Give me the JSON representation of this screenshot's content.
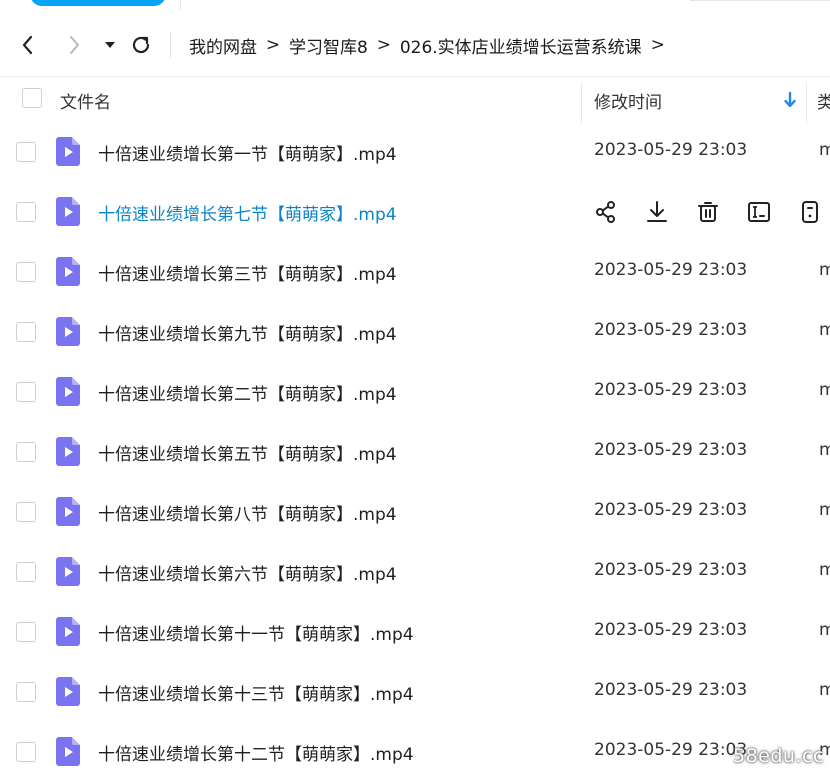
{
  "nav": {
    "back_icon": "chevron-left-icon",
    "forward_icon": "chevron-right-icon",
    "history_icon": "caret-down-icon",
    "refresh_icon": "refresh-icon",
    "breadcrumb": [
      "我的网盘",
      "学习智库8",
      "026.实体店业绩增长运营系统课"
    ],
    "separator": ">"
  },
  "header": {
    "name_col": "文件名",
    "time_col": "修改时间",
    "type_col": "类"
  },
  "files": [
    {
      "name": "十倍速业绩增长第一节【萌萌家】.mp4",
      "time": "2023-05-29 23:03",
      "type": "m"
    },
    {
      "name": "十倍速业绩增长第七节【萌萌家】.mp4",
      "time": "",
      "type": "",
      "hover": true
    },
    {
      "name": "十倍速业绩增长第三节【萌萌家】.mp4",
      "time": "2023-05-29 23:03",
      "type": "m"
    },
    {
      "name": "十倍速业绩增长第九节【萌萌家】.mp4",
      "time": "2023-05-29 23:03",
      "type": "m"
    },
    {
      "name": "十倍速业绩增长第二节【萌萌家】.mp4",
      "time": "2023-05-29 23:03",
      "type": "m"
    },
    {
      "name": "十倍速业绩增长第五节【萌萌家】.mp4",
      "time": "2023-05-29 23:03",
      "type": "m"
    },
    {
      "name": "十倍速业绩增长第八节【萌萌家】.mp4",
      "time": "2023-05-29 23:03",
      "type": "m"
    },
    {
      "name": "十倍速业绩增长第六节【萌萌家】.mp4",
      "time": "2023-05-29 23:03",
      "type": "m"
    },
    {
      "name": "十倍速业绩增长第十一节【萌萌家】.mp4",
      "time": "2023-05-29 23:03",
      "type": "m"
    },
    {
      "name": "十倍速业绩增长第十三节【萌萌家】.mp4",
      "time": "2023-05-29 23:03",
      "type": "m"
    },
    {
      "name": "十倍速业绩增长第十二节【萌萌家】.mp4",
      "time": "2023-05-29 23:03",
      "type": "m"
    }
  ],
  "row_actions": [
    "share-icon",
    "download-icon",
    "delete-icon",
    "rename-icon",
    "more-icon"
  ],
  "colors": {
    "accent": "#08a3f5",
    "hover_text": "#0a84c8",
    "video_icon": "#7b74f0",
    "sort_arrow": "#1e88e5"
  },
  "watermark": "58edu.cc"
}
